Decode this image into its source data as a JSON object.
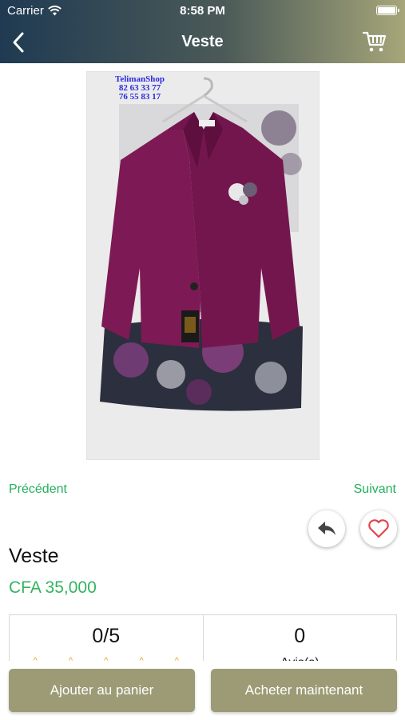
{
  "status_bar": {
    "carrier": "Carrier",
    "time": "8:58 PM"
  },
  "nav": {
    "title": "Veste",
    "back_icon": "chevron-left-icon",
    "cart_icon": "cart-icon"
  },
  "image": {
    "watermark_lines": [
      "TelimanShop",
      "82 63 33 77",
      "76 55 83 17"
    ]
  },
  "navigation": {
    "previous": "Précédent",
    "next": "Suivant"
  },
  "actions": {
    "share_icon": "reply-icon",
    "favorite_icon": "heart-icon"
  },
  "product": {
    "name": "Veste",
    "price": "CFA 35,000"
  },
  "stats": {
    "rating": "0/5",
    "stars": [
      "^",
      "^",
      "^",
      "^",
      "^"
    ],
    "count": "0",
    "count_label": "Avis(s)"
  },
  "buttons": {
    "add_to_cart": "Ajouter au panier",
    "buy_now": "Acheter maintenant"
  },
  "colors": {
    "accent_green": "#34b360",
    "button_olive": "#9c9b76",
    "heart_red": "#e0464a",
    "header_gradient_start": "#1f3a52",
    "header_gradient_end": "#a6a679"
  }
}
